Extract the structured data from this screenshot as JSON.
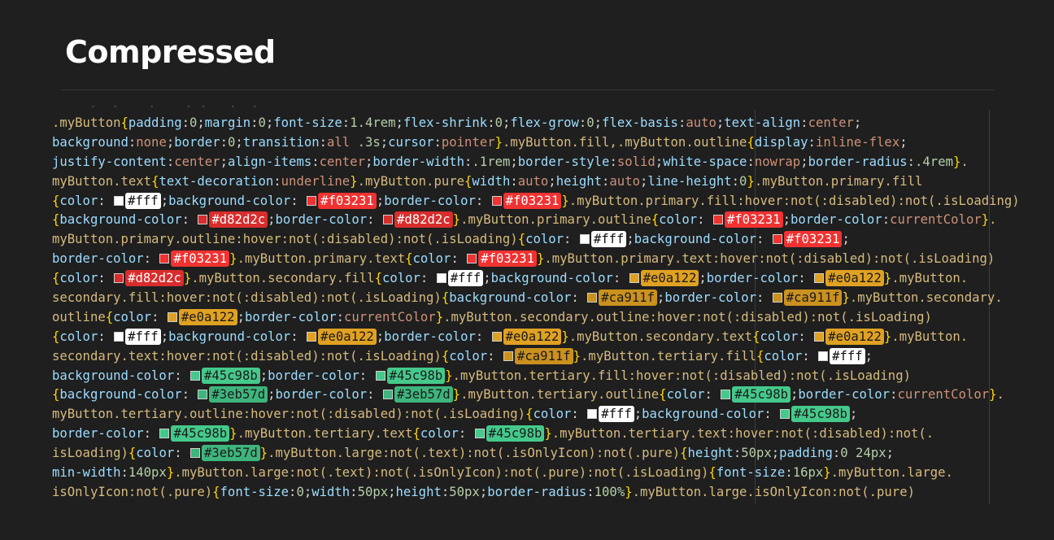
{
  "page": {
    "title": "Compressed"
  },
  "colors": {
    "fff": "#ffffff",
    "f03231": "#f03231",
    "d82d2c": "#d82d2c",
    "e0a122": "#e0a122",
    "ca911f": "#ca911f",
    "45c98b": "#45c98b",
    "3eb57d": "#3eb57d"
  },
  "code_lines": [
    [
      [
        "s",
        ".myButton"
      ],
      [
        "b",
        "{"
      ],
      [
        "p",
        "padding"
      ],
      [
        "t",
        ":"
      ],
      [
        "n",
        "0"
      ],
      [
        "t",
        ";"
      ],
      [
        "p",
        "margin"
      ],
      [
        "t",
        ":"
      ],
      [
        "n",
        "0"
      ],
      [
        "t",
        ";"
      ],
      [
        "p",
        "font-size"
      ],
      [
        "t",
        ":"
      ],
      [
        "n",
        "1.4rem"
      ],
      [
        "t",
        ";"
      ],
      [
        "p",
        "flex-shrink"
      ],
      [
        "t",
        ":"
      ],
      [
        "n",
        "0"
      ],
      [
        "t",
        ";"
      ],
      [
        "p",
        "flex-grow"
      ],
      [
        "t",
        ":"
      ],
      [
        "n",
        "0"
      ],
      [
        "t",
        ";"
      ],
      [
        "p",
        "flex-basis"
      ],
      [
        "t",
        ":"
      ],
      [
        "v",
        "auto"
      ],
      [
        "t",
        ";"
      ],
      [
        "p",
        "text-align"
      ],
      [
        "t",
        ":"
      ],
      [
        "v",
        "center"
      ],
      [
        "t",
        ";"
      ]
    ],
    [
      [
        "p",
        "background"
      ],
      [
        "t",
        ":"
      ],
      [
        "v",
        "none"
      ],
      [
        "t",
        ";"
      ],
      [
        "p",
        "border"
      ],
      [
        "t",
        ":"
      ],
      [
        "n",
        "0"
      ],
      [
        "t",
        ";"
      ],
      [
        "p",
        "transition"
      ],
      [
        "t",
        ":"
      ],
      [
        "v",
        "all "
      ],
      [
        "n",
        ".3s"
      ],
      [
        "t",
        ";"
      ],
      [
        "p",
        "cursor"
      ],
      [
        "t",
        ":"
      ],
      [
        "v",
        "pointer"
      ],
      [
        "b",
        "}"
      ],
      [
        "s",
        ".myButton.fill,.myButton.outline"
      ],
      [
        "b",
        "{"
      ],
      [
        "p",
        "display"
      ],
      [
        "t",
        ":"
      ],
      [
        "v",
        "inline-flex"
      ],
      [
        "t",
        ";"
      ]
    ],
    [
      [
        "p",
        "justify-content"
      ],
      [
        "t",
        ":"
      ],
      [
        "v",
        "center"
      ],
      [
        "t",
        ";"
      ],
      [
        "p",
        "align-items"
      ],
      [
        "t",
        ":"
      ],
      [
        "v",
        "center"
      ],
      [
        "t",
        ";"
      ],
      [
        "p",
        "border-width"
      ],
      [
        "t",
        ":"
      ],
      [
        "n",
        ".1rem"
      ],
      [
        "t",
        ";"
      ],
      [
        "p",
        "border-style"
      ],
      [
        "t",
        ":"
      ],
      [
        "v",
        "solid"
      ],
      [
        "t",
        ";"
      ],
      [
        "p",
        "white-space"
      ],
      [
        "t",
        ":"
      ],
      [
        "v",
        "nowrap"
      ],
      [
        "t",
        ";"
      ],
      [
        "p",
        "border-radius"
      ],
      [
        "t",
        ":"
      ],
      [
        "n",
        ".4rem"
      ],
      [
        "b",
        "}"
      ],
      [
        "s",
        "."
      ]
    ],
    [
      [
        "s",
        "myButton.text"
      ],
      [
        "b",
        "{"
      ],
      [
        "p",
        "text-decoration"
      ],
      [
        "t",
        ":"
      ],
      [
        "v",
        "underline"
      ],
      [
        "b",
        "}"
      ],
      [
        "s",
        ".myButton.pure"
      ],
      [
        "b",
        "{"
      ],
      [
        "p",
        "width"
      ],
      [
        "t",
        ":"
      ],
      [
        "v",
        "auto"
      ],
      [
        "t",
        ";"
      ],
      [
        "p",
        "height"
      ],
      [
        "t",
        ":"
      ],
      [
        "v",
        "auto"
      ],
      [
        "t",
        ";"
      ],
      [
        "p",
        "line-height"
      ],
      [
        "t",
        ":"
      ],
      [
        "n",
        "0"
      ],
      [
        "b",
        "}"
      ],
      [
        "s",
        ".myButton.primary.fill"
      ]
    ],
    [
      [
        "b",
        "{"
      ],
      [
        "p",
        "color"
      ],
      [
        "t",
        ": "
      ],
      [
        "c",
        "fff",
        "#fff"
      ],
      [
        "t",
        ";"
      ],
      [
        "p",
        "background-color"
      ],
      [
        "t",
        ": "
      ],
      [
        "c",
        "f03231",
        "#f03231"
      ],
      [
        "t",
        ";"
      ],
      [
        "p",
        "border-color"
      ],
      [
        "t",
        ": "
      ],
      [
        "c",
        "f03231",
        "#f03231"
      ],
      [
        "b",
        "}"
      ],
      [
        "s",
        ".myButton.primary.fill:hover:not(:disabled):not(.isLoading)"
      ]
    ],
    [
      [
        "b",
        "{"
      ],
      [
        "p",
        "background-color"
      ],
      [
        "t",
        ": "
      ],
      [
        "c",
        "d82d2c",
        "#d82d2c"
      ],
      [
        "t",
        ";"
      ],
      [
        "p",
        "border-color"
      ],
      [
        "t",
        ": "
      ],
      [
        "c",
        "d82d2c",
        "#d82d2c"
      ],
      [
        "b",
        "}"
      ],
      [
        "s",
        ".myButton.primary.outline"
      ],
      [
        "b",
        "{"
      ],
      [
        "p",
        "color"
      ],
      [
        "t",
        ": "
      ],
      [
        "c",
        "f03231",
        "#f03231"
      ],
      [
        "t",
        ";"
      ],
      [
        "p",
        "border-color"
      ],
      [
        "t",
        ":"
      ],
      [
        "v",
        "currentColor"
      ],
      [
        "b",
        "}"
      ],
      [
        "s",
        "."
      ]
    ],
    [
      [
        "s",
        "myButton.primary.outline:hover:not(:disabled):not(.isLoading)"
      ],
      [
        "b",
        "{"
      ],
      [
        "p",
        "color"
      ],
      [
        "t",
        ": "
      ],
      [
        "c",
        "fff",
        "#fff"
      ],
      [
        "t",
        ";"
      ],
      [
        "p",
        "background-color"
      ],
      [
        "t",
        ": "
      ],
      [
        "c",
        "f03231",
        "#f03231"
      ],
      [
        "t",
        ";"
      ]
    ],
    [
      [
        "p",
        "border-color"
      ],
      [
        "t",
        ": "
      ],
      [
        "c",
        "f03231",
        "#f03231"
      ],
      [
        "b",
        "}"
      ],
      [
        "s",
        ".myButton.primary.text"
      ],
      [
        "b",
        "{"
      ],
      [
        "p",
        "color"
      ],
      [
        "t",
        ": "
      ],
      [
        "c",
        "f03231",
        "#f03231"
      ],
      [
        "b",
        "}"
      ],
      [
        "s",
        ".myButton.primary.text:hover:not(:disabled):not(.isLoading)"
      ]
    ],
    [
      [
        "b",
        "{"
      ],
      [
        "p",
        "color"
      ],
      [
        "t",
        ": "
      ],
      [
        "c",
        "d82d2c",
        "#d82d2c"
      ],
      [
        "b",
        "}"
      ],
      [
        "s",
        ".myButton.secondary.fill"
      ],
      [
        "b",
        "{"
      ],
      [
        "p",
        "color"
      ],
      [
        "t",
        ": "
      ],
      [
        "c",
        "fff",
        "#fff"
      ],
      [
        "t",
        ";"
      ],
      [
        "p",
        "background-color"
      ],
      [
        "t",
        ": "
      ],
      [
        "c",
        "e0a122",
        "#e0a122"
      ],
      [
        "t",
        ";"
      ],
      [
        "p",
        "border-color"
      ],
      [
        "t",
        ": "
      ],
      [
        "c",
        "e0a122",
        "#e0a122"
      ],
      [
        "b",
        "}"
      ],
      [
        "s",
        ".myButton."
      ]
    ],
    [
      [
        "s",
        "secondary.fill:hover:not(:disabled):not(.isLoading)"
      ],
      [
        "b",
        "{"
      ],
      [
        "p",
        "background-color"
      ],
      [
        "t",
        ": "
      ],
      [
        "c",
        "ca911f",
        "#ca911f"
      ],
      [
        "t",
        ";"
      ],
      [
        "p",
        "border-color"
      ],
      [
        "t",
        ": "
      ],
      [
        "c",
        "ca911f",
        "#ca911f"
      ],
      [
        "b",
        "}"
      ],
      [
        "s",
        ".myButton.secondary."
      ]
    ],
    [
      [
        "s",
        "outline"
      ],
      [
        "b",
        "{"
      ],
      [
        "p",
        "color"
      ],
      [
        "t",
        ": "
      ],
      [
        "c",
        "e0a122",
        "#e0a122"
      ],
      [
        "t",
        ";"
      ],
      [
        "p",
        "border-color"
      ],
      [
        "t",
        ":"
      ],
      [
        "v",
        "currentColor"
      ],
      [
        "b",
        "}"
      ],
      [
        "s",
        ".myButton.secondary.outline:hover:not(:disabled):not(.isLoading)"
      ]
    ],
    [
      [
        "b",
        "{"
      ],
      [
        "p",
        "color"
      ],
      [
        "t",
        ": "
      ],
      [
        "c",
        "fff",
        "#fff"
      ],
      [
        "t",
        ";"
      ],
      [
        "p",
        "background-color"
      ],
      [
        "t",
        ": "
      ],
      [
        "c",
        "e0a122",
        "#e0a122"
      ],
      [
        "t",
        ";"
      ],
      [
        "p",
        "border-color"
      ],
      [
        "t",
        ": "
      ],
      [
        "c",
        "e0a122",
        "#e0a122"
      ],
      [
        "b",
        "}"
      ],
      [
        "s",
        ".myButton.secondary.text"
      ],
      [
        "b",
        "{"
      ],
      [
        "p",
        "color"
      ],
      [
        "t",
        ": "
      ],
      [
        "c",
        "e0a122",
        "#e0a122"
      ],
      [
        "b",
        "}"
      ],
      [
        "s",
        ".myButton."
      ]
    ],
    [
      [
        "s",
        "secondary.text:hover:not(:disabled):not(.isLoading)"
      ],
      [
        "b",
        "{"
      ],
      [
        "p",
        "color"
      ],
      [
        "t",
        ": "
      ],
      [
        "c",
        "ca911f",
        "#ca911f"
      ],
      [
        "b",
        "}"
      ],
      [
        "s",
        ".myButton.tertiary.fill"
      ],
      [
        "b",
        "{"
      ],
      [
        "p",
        "color"
      ],
      [
        "t",
        ": "
      ],
      [
        "c",
        "fff",
        "#fff"
      ],
      [
        "t",
        ";"
      ]
    ],
    [
      [
        "p",
        "background-color"
      ],
      [
        "t",
        ": "
      ],
      [
        "c",
        "45c98b",
        "#45c98b"
      ],
      [
        "t",
        ";"
      ],
      [
        "p",
        "border-color"
      ],
      [
        "t",
        ": "
      ],
      [
        "c",
        "45c98b",
        "#45c98b"
      ],
      [
        "b",
        "}"
      ],
      [
        "s",
        ".myButton.tertiary.fill:hover:not(:disabled):not(.isLoading)"
      ]
    ],
    [
      [
        "b",
        "{"
      ],
      [
        "p",
        "background-color"
      ],
      [
        "t",
        ": "
      ],
      [
        "c",
        "3eb57d",
        "#3eb57d"
      ],
      [
        "t",
        ";"
      ],
      [
        "p",
        "border-color"
      ],
      [
        "t",
        ": "
      ],
      [
        "c",
        "3eb57d",
        "#3eb57d"
      ],
      [
        "b",
        "}"
      ],
      [
        "s",
        ".myButton.tertiary.outline"
      ],
      [
        "b",
        "{"
      ],
      [
        "p",
        "color"
      ],
      [
        "t",
        ": "
      ],
      [
        "c",
        "45c98b",
        "#45c98b"
      ],
      [
        "t",
        ";"
      ],
      [
        "p",
        "border-color"
      ],
      [
        "t",
        ":"
      ],
      [
        "v",
        "currentColor"
      ],
      [
        "b",
        "}"
      ],
      [
        "s",
        "."
      ]
    ],
    [
      [
        "s",
        "myButton.tertiary.outline:hover:not(:disabled):not(.isLoading)"
      ],
      [
        "b",
        "{"
      ],
      [
        "p",
        "color"
      ],
      [
        "t",
        ": "
      ],
      [
        "c",
        "fff",
        "#fff"
      ],
      [
        "t",
        ";"
      ],
      [
        "p",
        "background-color"
      ],
      [
        "t",
        ": "
      ],
      [
        "c",
        "45c98b",
        "#45c98b"
      ],
      [
        "t",
        ";"
      ]
    ],
    [
      [
        "p",
        "border-color"
      ],
      [
        "t",
        ": "
      ],
      [
        "c",
        "45c98b",
        "#45c98b"
      ],
      [
        "b",
        "}"
      ],
      [
        "s",
        ".myButton.tertiary.text"
      ],
      [
        "b",
        "{"
      ],
      [
        "p",
        "color"
      ],
      [
        "t",
        ": "
      ],
      [
        "c",
        "45c98b",
        "#45c98b"
      ],
      [
        "b",
        "}"
      ],
      [
        "s",
        ".myButton.tertiary.text:hover:not(:disabled):not(."
      ]
    ],
    [
      [
        "s",
        "isLoading)"
      ],
      [
        "b",
        "{"
      ],
      [
        "p",
        "color"
      ],
      [
        "t",
        ": "
      ],
      [
        "c",
        "3eb57d",
        "#3eb57d"
      ],
      [
        "b",
        "}"
      ],
      [
        "s",
        ".myButton.large:not(.text):not(.isOnlyIcon):not(.pure)"
      ],
      [
        "b",
        "{"
      ],
      [
        "p",
        "height"
      ],
      [
        "t",
        ":"
      ],
      [
        "n",
        "50px"
      ],
      [
        "t",
        ";"
      ],
      [
        "p",
        "padding"
      ],
      [
        "t",
        ":"
      ],
      [
        "n",
        "0 24px"
      ],
      [
        "t",
        ";"
      ]
    ],
    [
      [
        "p",
        "min-width"
      ],
      [
        "t",
        ":"
      ],
      [
        "n",
        "140px"
      ],
      [
        "b",
        "}"
      ],
      [
        "s",
        ".myButton.large:not(.text):not(.isOnlyIcon):not(.pure):not(.isLoading)"
      ],
      [
        "b",
        "{"
      ],
      [
        "p",
        "font-size"
      ],
      [
        "t",
        ":"
      ],
      [
        "n",
        "16px"
      ],
      [
        "b",
        "}"
      ],
      [
        "s",
        ".myButton.large."
      ]
    ],
    [
      [
        "s",
        "isOnlyIcon:not(.pure)"
      ],
      [
        "b",
        "{"
      ],
      [
        "p",
        "font-size"
      ],
      [
        "t",
        ":"
      ],
      [
        "n",
        "0"
      ],
      [
        "t",
        ";"
      ],
      [
        "p",
        "width"
      ],
      [
        "t",
        ":"
      ],
      [
        "n",
        "50px"
      ],
      [
        "t",
        ";"
      ],
      [
        "p",
        "height"
      ],
      [
        "t",
        ":"
      ],
      [
        "n",
        "50px"
      ],
      [
        "t",
        ";"
      ],
      [
        "p",
        "border-radius"
      ],
      [
        "t",
        ":"
      ],
      [
        "n",
        "100%"
      ],
      [
        "b",
        "}"
      ],
      [
        "s",
        ".myButton.large.isOnlyIcon:not(.pure)"
      ]
    ]
  ]
}
